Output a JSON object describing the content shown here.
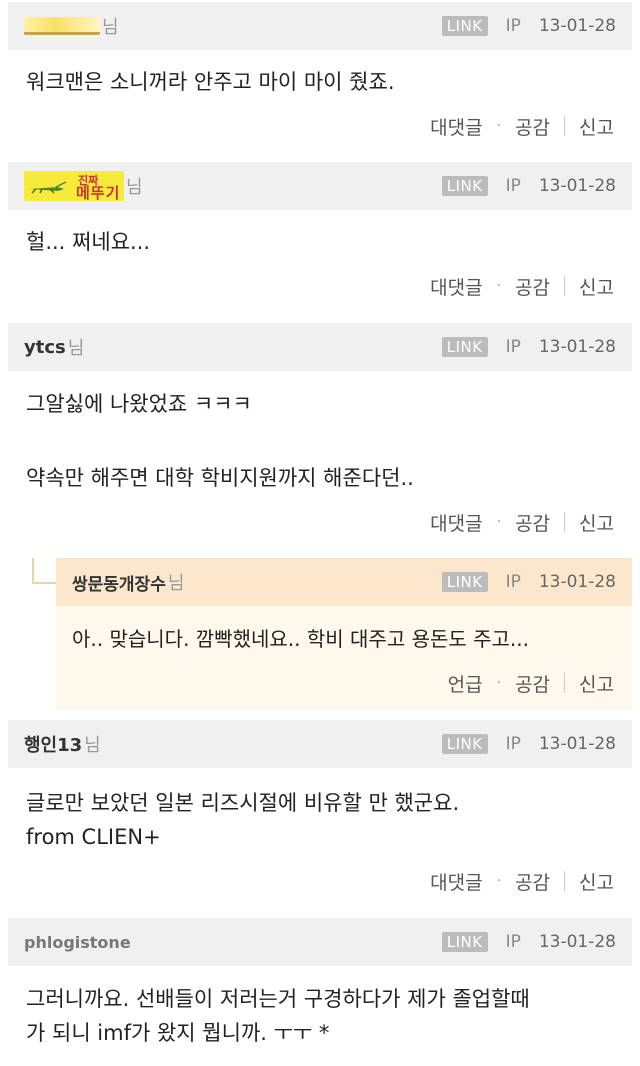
{
  "comments": [
    {
      "author_suffix": "님",
      "badge": "LINK",
      "ip": "IP",
      "date": "13-01-28",
      "lines": [
        "워크맨은 소니꺼라 안주고 마이 마이 줬죠."
      ],
      "actions": {
        "reply": "대댓글",
        "like": "공감",
        "report": "신고"
      }
    },
    {
      "author_suffix": "님",
      "nick_image_text_top": "진짜",
      "nick_image_text_bottom": "메뚜기",
      "badge": "LINK",
      "ip": "IP",
      "date": "13-01-28",
      "lines": [
        "헐... 쩌네요..."
      ],
      "actions": {
        "reply": "대댓글",
        "like": "공감",
        "report": "신고"
      }
    },
    {
      "author": "ytcs",
      "author_suffix": "님",
      "badge": "LINK",
      "ip": "IP",
      "date": "13-01-28",
      "lines": [
        "그알싫에 나왔었죠 ㅋㅋㅋ",
        "약속만 해주면 대학 학비지원까지 해준다던.."
      ],
      "actions": {
        "reply": "대댓글",
        "like": "공감",
        "report": "신고"
      }
    },
    {
      "author": "행인13",
      "author_suffix": "님",
      "badge": "LINK",
      "ip": "IP",
      "date": "13-01-28",
      "lines": [
        "글로만 보았던 일본 리즈시절에 비유할 만 했군요.",
        "from CLIEN+"
      ],
      "actions": {
        "reply": "대댓글",
        "like": "공감",
        "report": "신고"
      }
    },
    {
      "author": "phlogistone",
      "author_suffix": "",
      "badge": "LINK",
      "ip": "IP",
      "date": "13-01-28",
      "lines": [
        "그러니까요. 선배들이 저러는거 구경하다가 제가 졸업할때",
        "가 되니 imf가 왔지 뭡니까. ㅜㅜ *"
      ]
    }
  ],
  "reply": {
    "author": "쌍문동개장수",
    "author_suffix": "님",
    "badge": "LINK",
    "ip": "IP",
    "date": "13-01-28",
    "text": "아.. 맞습니다. 깜빡했네요.. 학비 대주고 용돈도 주고...",
    "actions": {
      "mention": "언급",
      "like": "공감",
      "report": "신고"
    }
  },
  "colors": {
    "header_bg": "#f0f0f0",
    "reply_header_bg": "#fbe8cc",
    "reply_bg": "#fff8ec",
    "badge_bg": "#bcbcbc"
  }
}
